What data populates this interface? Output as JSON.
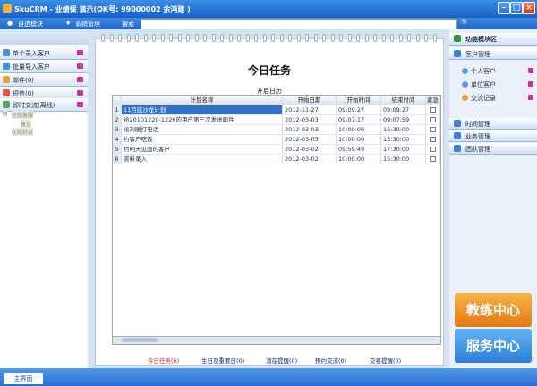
{
  "titlebar": {
    "title": "SkuCRM - 业绩保 演示(OK号: 99000002 余鸿建 )"
  },
  "menubar": {
    "items": [
      "自选模块",
      "系统管理",
      "搜索"
    ]
  },
  "left": {
    "items": [
      {
        "label": "单个录入客户"
      },
      {
        "label": "批量导入客户"
      },
      {
        "label": "邮件(0)"
      },
      {
        "label": "短信(0)"
      },
      {
        "label": "即时交流(离线)"
      }
    ],
    "tree": [
      "在线客服",
      "留言",
      "在线好友"
    ]
  },
  "main": {
    "title": "今日任务",
    "subtitle": "开启日历",
    "columns": [
      "计划名称",
      "开始日期",
      "开始时间",
      "结束时间",
      "紧急"
    ],
    "rows": [
      {
        "idx": "1",
        "name": "11月底沙龙计划",
        "date": "2012-11-27",
        "start": "09:09:27",
        "end": "09:09:27"
      },
      {
        "idx": "2",
        "name": "给20101220-1226的用户第三次发送邮件",
        "date": "2012-03-03",
        "start": "09:07:17",
        "end": "09:07:59"
      },
      {
        "idx": "3",
        "name": "给刘暖打电话",
        "date": "2012-03-03",
        "start": "10:00:00",
        "end": "15:30:00"
      },
      {
        "idx": "4",
        "name": "约客户吃饭",
        "date": "2012-03-03",
        "start": "10:00:00",
        "end": "15:30:00"
      },
      {
        "idx": "5",
        "name": "约明天见面的客户",
        "date": "2012-03-02",
        "start": "09:59:49",
        "end": "17:30:00"
      },
      {
        "idx": "6",
        "name": "资料录入",
        "date": "2012-03-02",
        "start": "10:00:00",
        "end": "15:30:00"
      }
    ],
    "tabs": [
      "今日任务(6)",
      "生日及重要日(0)",
      "潜在提醒(0)",
      "预约交流(0)",
      "交易提醒(0)"
    ]
  },
  "right": {
    "header": "功能模块区",
    "sections": [
      {
        "label": "客户管理"
      },
      {
        "label": "时间管理"
      },
      {
        "label": "业务管理"
      },
      {
        "label": "团队管理"
      }
    ],
    "subitems": [
      "个人客户",
      "单位客户",
      "交流记录"
    ],
    "buttons": [
      "教练中心",
      "服务中心"
    ]
  },
  "statusbar": {
    "tab": "主界面"
  },
  "colors": {
    "accent": "#2a6fd0",
    "selected": "#3272c6",
    "orange": "#f08a1c",
    "blue": "#3d8de0"
  }
}
